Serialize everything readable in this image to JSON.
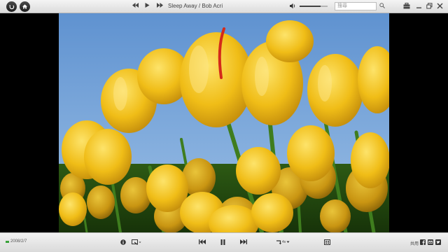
{
  "header": {
    "track_title": "Sleep Away / Bob Acri",
    "search_placeholder": "搜尋",
    "volume_level": 0.75
  },
  "photo": {
    "subject": "yellow-tulips"
  },
  "footer": {
    "date": "2008/2/7",
    "speed_label": "4x",
    "share_label": "共用"
  },
  "icons": {
    "back": "back-icon",
    "home": "home-icon",
    "prev": "previous-icon",
    "play": "play-icon",
    "next": "next-icon",
    "volume": "volume-icon",
    "search": "search-icon",
    "toolbox": "toolbox-icon",
    "minimize": "minimize-icon",
    "restore": "restore-icon",
    "close": "close-icon",
    "info": "info-icon",
    "zoom": "zoom-icon",
    "pause": "pause-icon",
    "rotate": "rotate-icon",
    "slideshow": "slideshow-icon",
    "facebook": "facebook-icon",
    "email": "email-icon",
    "twitter": "twitter-icon"
  },
  "colors": {
    "bar_bg": "#e6e6e6",
    "sky": "#6e9fd6",
    "tulip": "#f2c21a",
    "stem": "#3f7d1e"
  }
}
